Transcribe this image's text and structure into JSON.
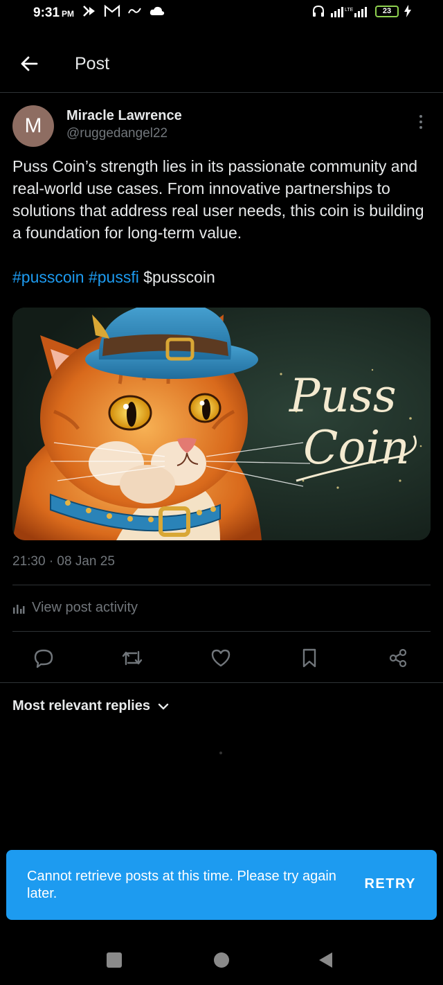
{
  "status_bar": {
    "time": "9:31",
    "ampm": "PM",
    "battery": "23"
  },
  "header": {
    "title": "Post"
  },
  "post": {
    "author_initial": "M",
    "author_name": "Miracle Lawrence",
    "author_handle": "@ruggedangel22",
    "text": "Puss Coin’s strength lies in its passionate community and real-world use cases. From innovative partnerships to solutions that address real user needs, this coin is building a foundation for long-term value.",
    "tags": [
      "#pusscoin",
      "#pussfi",
      "$pusscoin"
    ],
    "image_title_line1": "Puss",
    "image_title_line2": "Coin",
    "timestamp": "21:30 · 08 Jan 25",
    "activity_label": "View post activity"
  },
  "replies": {
    "sort_label": "Most relevant replies"
  },
  "toast": {
    "message": "Cannot retrieve posts at this time. Please try again later.",
    "action": "RETRY"
  },
  "colors": {
    "accent": "#1d9bf0",
    "background": "#000000",
    "divider": "#2f3336",
    "muted_text": "#71767b"
  }
}
